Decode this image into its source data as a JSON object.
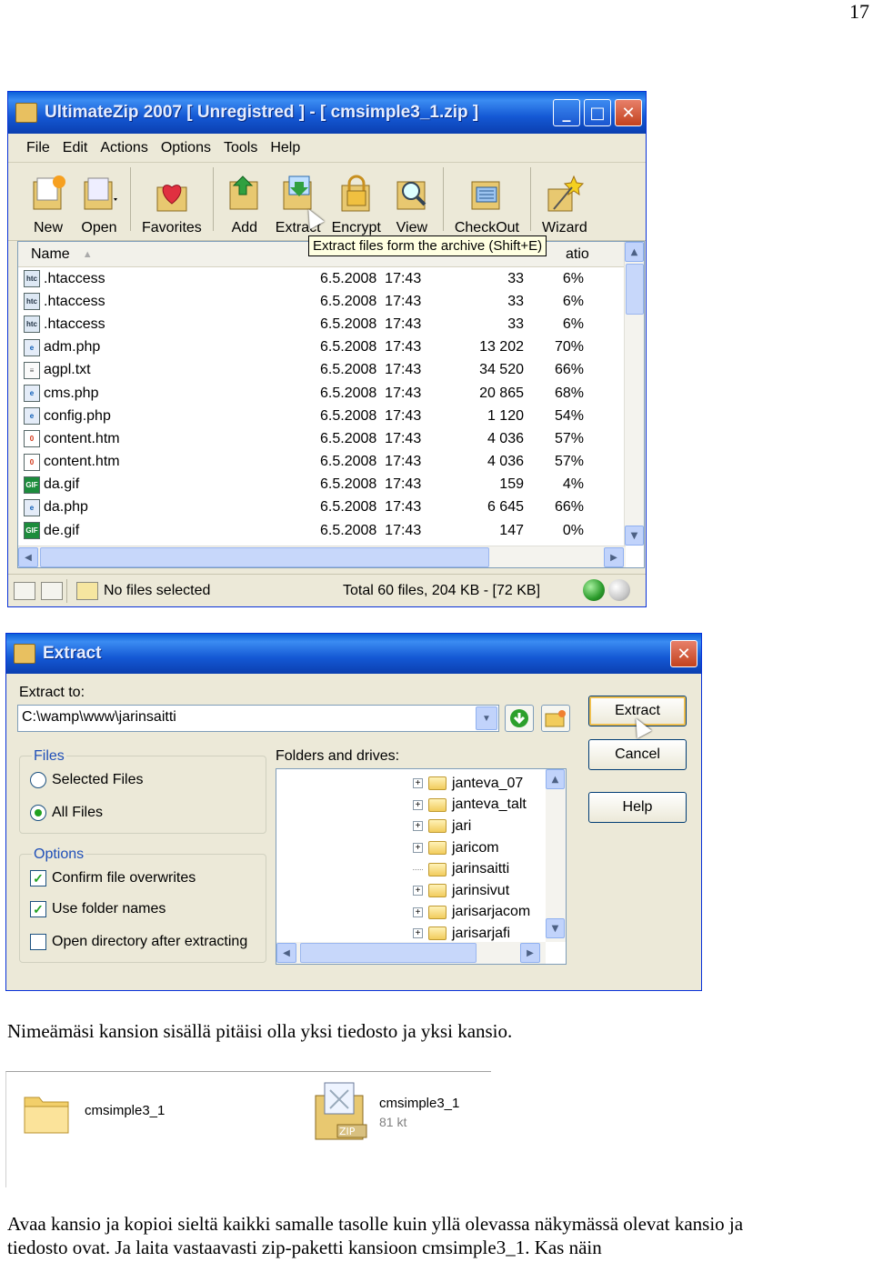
{
  "page_number": "17",
  "main_window": {
    "title": "UltimateZip 2007 [ Unregistred ] - [ cmsimple3_1.zip ]",
    "controls": {
      "minimize": "_",
      "maximize": "□",
      "close": "✕"
    },
    "menu": [
      "File",
      "Edit",
      "Actions",
      "Options",
      "Tools",
      "Help"
    ],
    "toolbar": {
      "new": "New",
      "open": "Open",
      "favorites": "Favorites",
      "add": "Add",
      "extract": "Extract",
      "encrypt": "Encrypt",
      "view": "View",
      "checkout": "CheckOut",
      "wizard": "Wizard"
    },
    "tooltip": "Extract files form the archive (Shift+E)",
    "columns": {
      "name": "Name",
      "ratio": "atio"
    },
    "files": [
      {
        "name": ".htaccess",
        "type": "ht",
        "date": "6.5.2008  17:43",
        "size": "33",
        "ratio": "6%"
      },
      {
        "name": ".htaccess",
        "type": "ht",
        "date": "6.5.2008  17:43",
        "size": "33",
        "ratio": "6%"
      },
      {
        "name": ".htaccess",
        "type": "ht",
        "date": "6.5.2008  17:43",
        "size": "33",
        "ratio": "6%"
      },
      {
        "name": "adm.php",
        "type": "php",
        "date": "6.5.2008  17:43",
        "size": "13 202",
        "ratio": "70%"
      },
      {
        "name": "agpl.txt",
        "type": "txt",
        "date": "6.5.2008  17:43",
        "size": "34 520",
        "ratio": "66%"
      },
      {
        "name": "cms.php",
        "type": "php",
        "date": "6.5.2008  17:43",
        "size": "20 865",
        "ratio": "68%"
      },
      {
        "name": "config.php",
        "type": "php",
        "date": "6.5.2008  17:43",
        "size": "1 120",
        "ratio": "54%"
      },
      {
        "name": "content.htm",
        "type": "htm",
        "date": "6.5.2008  17:43",
        "size": "4 036",
        "ratio": "57%"
      },
      {
        "name": "content.htm",
        "type": "htm",
        "date": "6.5.2008  17:43",
        "size": "4 036",
        "ratio": "57%"
      },
      {
        "name": "da.gif",
        "type": "gif",
        "date": "6.5.2008  17:43",
        "size": "159",
        "ratio": "4%"
      },
      {
        "name": "da.php",
        "type": "php",
        "date": "6.5.2008  17:43",
        "size": "6 645",
        "ratio": "66%"
      },
      {
        "name": "de.gif",
        "type": "gif",
        "date": "6.5.2008  17:43",
        "size": "147",
        "ratio": "0%"
      }
    ],
    "status": {
      "selection": "No files selected",
      "total": "Total 60 files, 204 KB - [72 KB]"
    }
  },
  "extract_dialog": {
    "title": "Extract",
    "extract_to_label": "Extract to:",
    "path": "C:\\wamp\\www\\jarinsaitti",
    "files_group": "Files",
    "selected_files": "Selected Files",
    "all_files": "All Files",
    "options_group": "Options",
    "confirm_overwrites": "Confirm file overwrites",
    "use_folder_names": "Use folder names",
    "open_directory": "Open directory after extracting",
    "folders_label": "Folders and drives:",
    "folders": [
      {
        "name": "janteva_07",
        "expandable": true
      },
      {
        "name": "janteva_talt",
        "expandable": true
      },
      {
        "name": "jari",
        "expandable": true
      },
      {
        "name": "jaricom",
        "expandable": true
      },
      {
        "name": "jarinsaitti",
        "expandable": false
      },
      {
        "name": "jarinsivut",
        "expandable": true
      },
      {
        "name": "jarisarjacom",
        "expandable": true
      },
      {
        "name": "jarisarjafi",
        "expandable": true
      }
    ],
    "buttons": {
      "extract": "Extract",
      "cancel": "Cancel",
      "help": "Help"
    }
  },
  "paragraph1": "Nimeämäsi kansion sisällä pitäisi olla yksi tiedosto ja yksi kansio.",
  "explorer": {
    "folder_name": "cmsimple3_1",
    "zip_name": "cmsimple3_1",
    "zip_size": "81 kt",
    "zip_badge": "ZIP"
  },
  "paragraph2_line1": "Avaa kansio ja kopioi sieltä kaikki samalle tasolle kuin yllä olevassa näkymässä olevat kansio ja",
  "paragraph2_line2": "tiedosto ovat. Ja laita vastaavasti zip-paketti kansioon cmsimple3_1. Kas näin"
}
